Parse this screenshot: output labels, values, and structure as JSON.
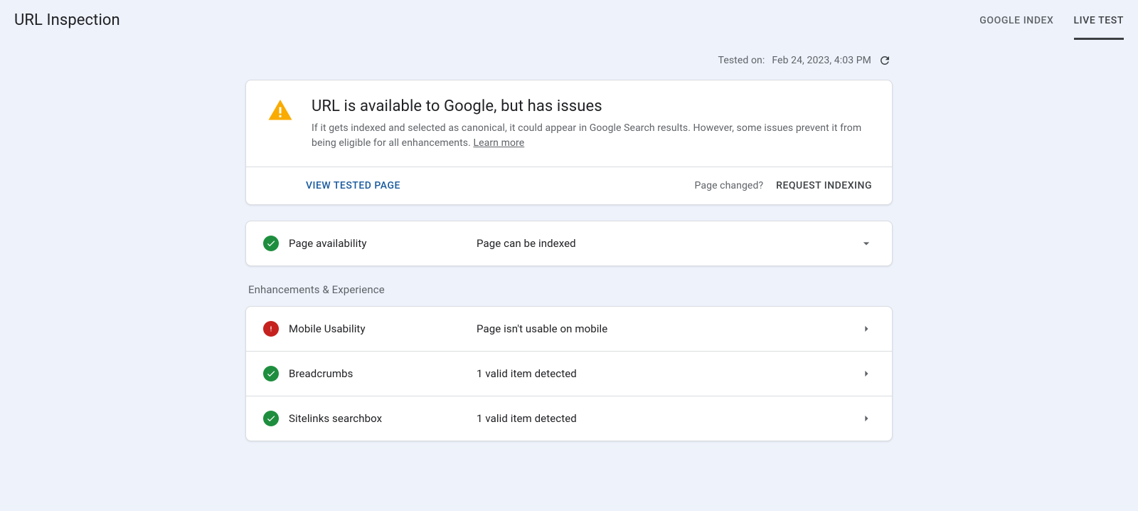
{
  "header": {
    "title": "URL Inspection",
    "tabs": {
      "google_index": "GOOGLE INDEX",
      "live_test": "LIVE TEST"
    }
  },
  "tested": {
    "prefix": "Tested on:",
    "timestamp": "Feb 24, 2023, 4:03 PM"
  },
  "summary": {
    "title": "URL is available to Google, but has issues",
    "description": "If it gets indexed and selected as canonical, it could appear in Google Search results. However, some issues prevent it from being eligible for all enhancements. ",
    "learn_more": "Learn more"
  },
  "actions": {
    "view_tested": "VIEW TESTED PAGE",
    "page_changed": "Page changed?",
    "request_indexing": "REQUEST INDEXING"
  },
  "availability": {
    "label": "Page availability",
    "value": "Page can be indexed"
  },
  "enhancements_header": "Enhancements & Experience",
  "enhancements": [
    {
      "status": "error",
      "label": "Mobile Usability",
      "value": "Page isn't usable on mobile"
    },
    {
      "status": "ok",
      "label": "Breadcrumbs",
      "value": "1 valid item detected"
    },
    {
      "status": "ok",
      "label": "Sitelinks searchbox",
      "value": "1 valid item detected"
    }
  ]
}
